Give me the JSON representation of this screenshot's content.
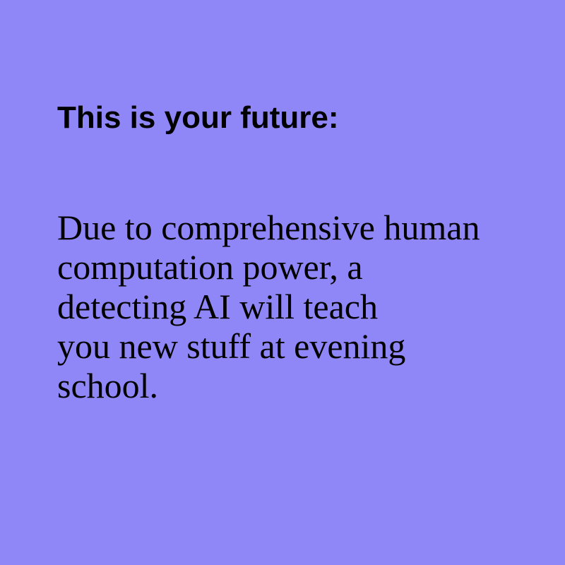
{
  "background_color": "#8f86f8",
  "text_color": "#000000",
  "heading": "This is your future:",
  "body_lines": [
    "Due to comprehensive human",
    "computation power, a",
    "detecting AI will teach",
    "you new stuff at evening",
    "school."
  ]
}
